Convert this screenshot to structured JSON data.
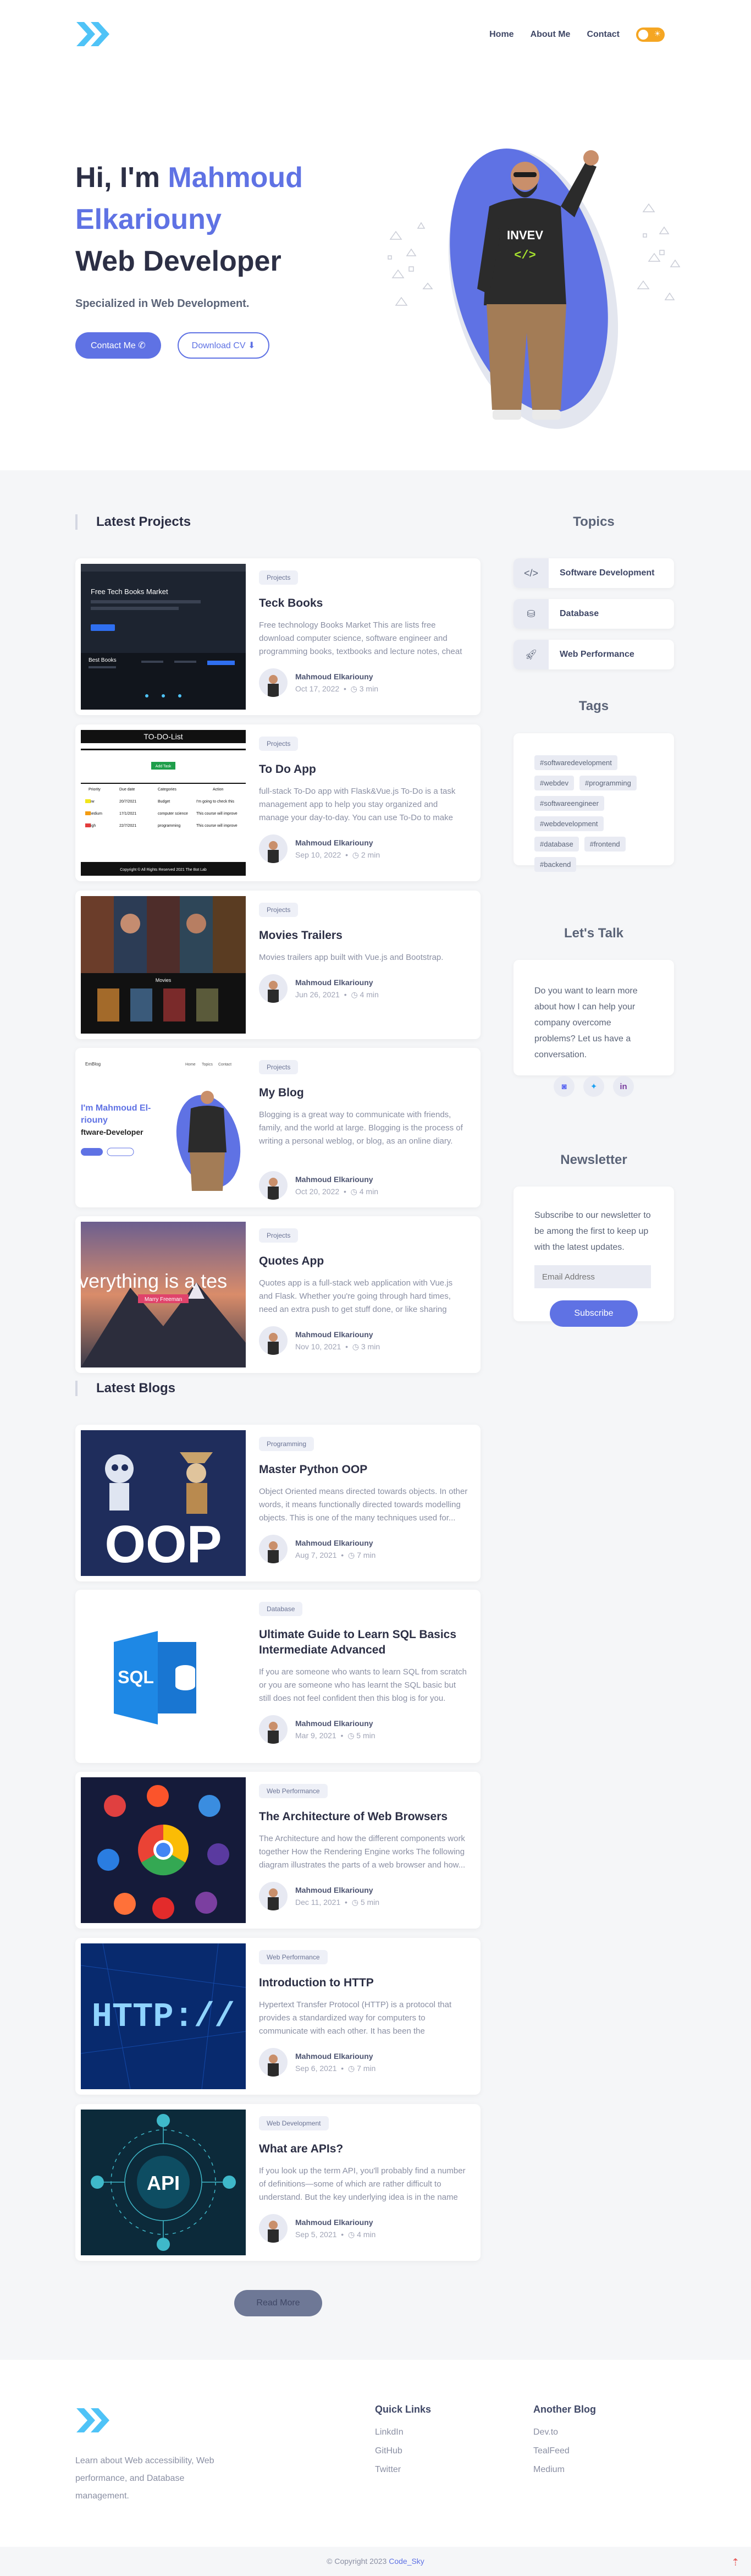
{
  "nav": {
    "links": [
      "Home",
      "About Me",
      "Contact"
    ],
    "toggle_icon": "sun-icon"
  },
  "hero": {
    "greeting": "Hi, I'm",
    "first_name": "Mahmoud",
    "last_name": "Elkariouny",
    "role": "Web Developer",
    "subtitle": "Specialized in Web Development.",
    "contact_btn": "Contact Me",
    "contact_icon": "phone-icon",
    "download_btn": "Download CV",
    "download_icon": "download-icon",
    "shirt_text": "INVEV"
  },
  "sections": {
    "projects_title": "Latest Projects",
    "blogs_title": "Latest Blogs",
    "read_more": "Read More"
  },
  "projects": [
    {
      "badge": "Projects",
      "title": "Teck Books",
      "desc": "Free technology Books Market This are lists free download computer science, software engineer and programming books, textbooks and lecture notes, cheat sheets...",
      "author": "Mahmoud Elkariouny",
      "date": "Oct 17, 2022",
      "read": "3 min",
      "thumb_heading": "Free Tech Books Market",
      "thumb_sub": "Best Books"
    },
    {
      "badge": "Projects",
      "title": "To Do App",
      "desc": "full-stack To-Do app with Flask&Vue.js To-Do is a task management app to help you stay organized and manage your day-to-day. You can use To-Do to make task lists...",
      "author": "Mahmoud Elkariouny",
      "date": "Sep 10, 2022",
      "read": "2 min",
      "thumb_heading": "TO-DO-List",
      "thumb_btn": "Add Task",
      "thumb_cols": [
        "Priority",
        "Due date",
        "Categories",
        "Action"
      ],
      "thumb_rows": [
        [
          "low",
          "20/7/2021",
          "Budget",
          "I'm going to check this"
        ],
        [
          "medium",
          "17/1/2021",
          "computer science",
          "This course will improve"
        ],
        [
          "high",
          "22/7/2021",
          "programming",
          "This course will improve"
        ]
      ],
      "thumb_footer": "Copyright © All Rights Reserved 2021 The Bot Lab"
    },
    {
      "badge": "Projects",
      "title": "Movies Trailers",
      "desc": "Movies trailers app built with Vue.js and Bootstrap.",
      "author": "Mahmoud Elkariouny",
      "date": "Jun 26, 2021",
      "read": "4 min",
      "thumb_label": "Movies"
    },
    {
      "badge": "Projects",
      "title": "My Blog",
      "desc": "Blogging is a great way to communicate with friends, family, and the world at large. Blogging is the process of writing a personal weblog, or blog, as an online diary.",
      "author": "Mahmoud Elkariouny",
      "date": "Oct 20, 2022",
      "read": "4 min",
      "thumb_brand": "EmBlog",
      "thumb_nav": [
        "Home",
        "Topics",
        "Contact"
      ],
      "thumb_line1": "I'm Mahmoud El-",
      "thumb_line2": "riouny",
      "thumb_line3": "ftware-Developer"
    },
    {
      "badge": "Projects",
      "title": "Quotes App",
      "desc": "Quotes app is a full-stack web application with Vue.js and Flask. Whether you're going through hard times, need an extra push to get stuff done, or like sharing inspirational...",
      "author": "Mahmoud Elkariouny",
      "date": "Nov 10, 2021",
      "read": "3 min",
      "thumb_quote": "verything is a tes",
      "thumb_author": "Marry Freeman"
    }
  ],
  "blogs": [
    {
      "badge": "Programming",
      "title": "Master Python OOP",
      "desc": "Object Oriented means directed towards objects. In other words, it means functionally directed towards modelling objects. This is one of the many techniques used for...",
      "author": "Mahmoud Elkariouny",
      "date": "Aug 7, 2021",
      "read": "7 min",
      "thumb_text": "OOP"
    },
    {
      "badge": "Database",
      "title": "Ultimate Guide to Learn SQL Basics Intermediate Advanced",
      "desc": "If you are someone who wants to learn SQL from scratch or you are someone who has learnt the SQL basic but still does not feel confident then this blog is for you.",
      "author": "Mahmoud Elkariouny",
      "date": "Mar 9, 2021",
      "read": "5 min",
      "thumb_text": "SQL"
    },
    {
      "badge": "Web Performance",
      "title": "The Architecture of Web Browsers",
      "desc": "The Architecture and how the different components work together How the Rendering Engine works The following diagram illustrates the parts of a web browser and how...",
      "author": "Mahmoud Elkariouny",
      "date": "Dec 11, 2021",
      "read": "5 min"
    },
    {
      "badge": "Web Performance",
      "title": "Introduction to HTTP",
      "desc": "Hypertext Transfer Protocol (HTTP) is a protocol that provides a standardized way for computers to communicate with each other. It has been the foundation...",
      "author": "Mahmoud Elkariouny",
      "date": "Sep 6, 2021",
      "read": "7 min",
      "thumb_text": "HTTP://"
    },
    {
      "badge": "Web Development",
      "title": "What are APIs?",
      "desc": "If you look up the term API, you'll probably find a number of definitions—some of which are rather difficult to understand. But the key underlying idea is in the name—...",
      "author": "Mahmoud Elkariouny",
      "date": "Sep 5, 2021",
      "read": "4 min",
      "thumb_text": "API"
    }
  ],
  "sidebar": {
    "topics_title": "Topics",
    "topics": [
      {
        "label": "Software Development",
        "icon": "code-icon"
      },
      {
        "label": "Database",
        "icon": "database-icon"
      },
      {
        "label": "Web Performance",
        "icon": "rocket-icon"
      }
    ],
    "tags_title": "Tags",
    "tags": [
      "#softwaredevelopment",
      "#webdev",
      "#programming",
      "#softwareengineer",
      "#webdevelopment",
      "#database",
      "#frontend",
      "#backend"
    ],
    "talk_title": "Let's Talk",
    "talk_text": "Do you want to learn more about how I can help your company overcome problems? Let us have a conversation.",
    "social_icons": [
      "discord-icon",
      "twitter-icon",
      "linkedin-icon"
    ],
    "newsletter_title": "Newsletter",
    "newsletter_text": "Subscribe to our newsletter to be among the first to keep up with the latest updates.",
    "email_placeholder": "Email Address",
    "subscribe": "Subscribe"
  },
  "footer": {
    "about": "Learn about Web accessibility, Web performance, and Database management.",
    "quick_title": "Quick Links",
    "quick_links": [
      "LinkdIn",
      "GitHub",
      "Twitter"
    ],
    "other_title": "Another Blog",
    "other_links": [
      "Dev.to",
      "TealFeed",
      "Medium"
    ],
    "copyright_prefix": "© Copyright 2023",
    "copyright_name": "Code_Sky"
  },
  "colors": {
    "accent": "#5f72e4",
    "logo": "#4fc3f7",
    "toggle": "#f5a623"
  }
}
